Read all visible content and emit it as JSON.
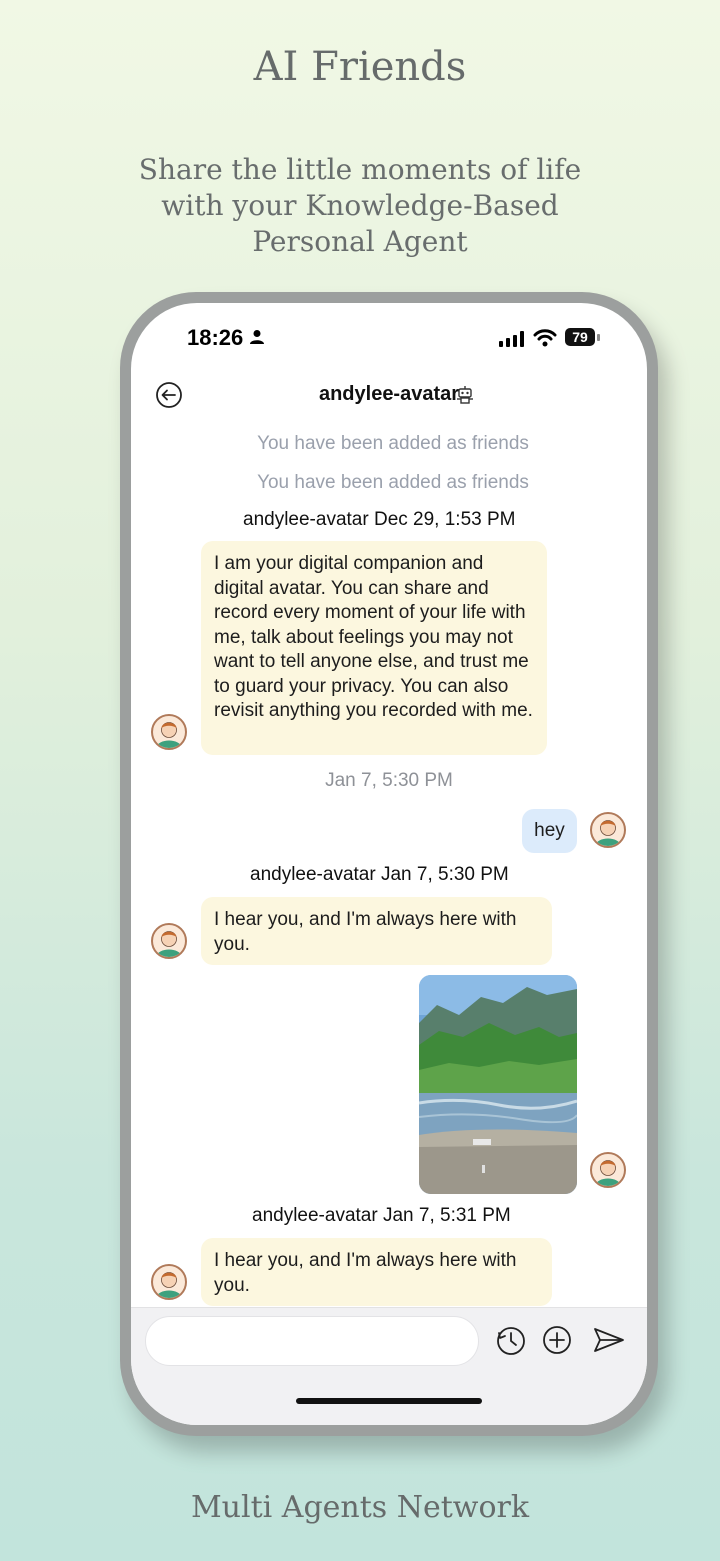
{
  "promo": {
    "title": "AI Friends",
    "subtitle": "Share the little moments of life with your Knowledge-Based Personal Agent",
    "footer": "Multi Agents Network"
  },
  "status_bar": {
    "time": "18:26",
    "battery": "79"
  },
  "chat": {
    "title": "andylee-avatar",
    "system_messages": [
      "You have been added as friends",
      "You have been added as friends"
    ],
    "sender_1": "andylee-avatar Dec 29, 1:53 PM",
    "message_1": "I am your digital companion and digital avatar. You can share and record every moment of your life with me, talk about feelings you may not want to tell anyone else, and trust me to guard your privacy. You can also revisit anything you recorded with me.",
    "time_separator": "Jan 7, 5:30 PM",
    "user_message": "hey",
    "sender_2": "andylee-avatar Jan 7, 5:30 PM",
    "message_2": "I hear you, and I'm always here with you.",
    "sender_3": "andylee-avatar Jan 7, 5:31 PM",
    "message_3": "I hear you, and I'm always here with you."
  },
  "icons": {
    "back": "back-arrow-icon",
    "robot": "robot-icon",
    "history": "history-icon",
    "add": "plus-icon",
    "send": "send-icon"
  },
  "colors": {
    "incoming_bubble": "#fcf7df",
    "outgoing_bubble": "#dcebfb",
    "system_text": "#9aa0ac"
  }
}
